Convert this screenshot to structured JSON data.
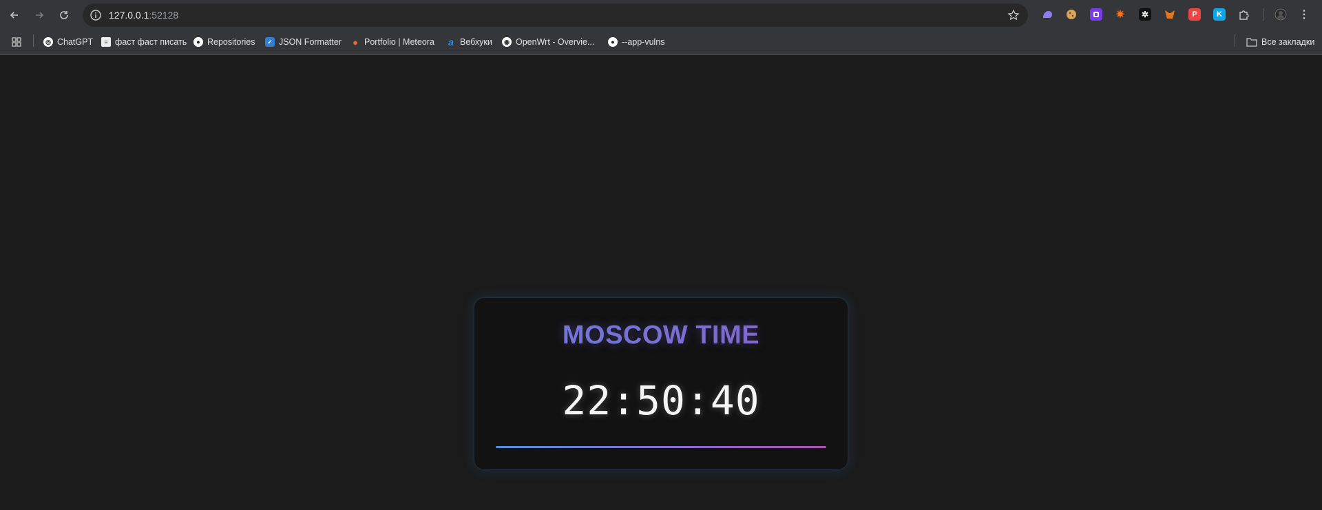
{
  "browser": {
    "url_host": "127.0.0.1",
    "url_port": ":52128",
    "bookmarks": [
      {
        "label": "ChatGPT",
        "icon": "chatgpt-icon"
      },
      {
        "label": "фаст фаст писать",
        "icon": "page-icon"
      },
      {
        "label": "Repositories",
        "icon": "github-icon"
      },
      {
        "label": "JSON Formatter",
        "icon": "checkbox-icon"
      },
      {
        "label": "Portfolio | Meteora",
        "icon": "meteora-icon"
      },
      {
        "label": "Вебхуки",
        "icon": "webhook-icon"
      },
      {
        "label": "OpenWrt - Overvie...",
        "icon": "openwrt-icon"
      },
      {
        "label": "--app-vulns",
        "icon": "github-icon"
      }
    ],
    "all_bookmarks_label": "Все закладки"
  },
  "clock_card": {
    "title": "MOSCOW TIME",
    "time": "22:50:40"
  },
  "colors": {
    "page_bg": "#1b1b1b",
    "card_bg": "#121212",
    "title_gradient_start": "#6c7fe0",
    "title_gradient_end": "#8a62c2",
    "underline_gradient_start": "#4a8fe0",
    "underline_gradient_end": "#b04fb8"
  }
}
